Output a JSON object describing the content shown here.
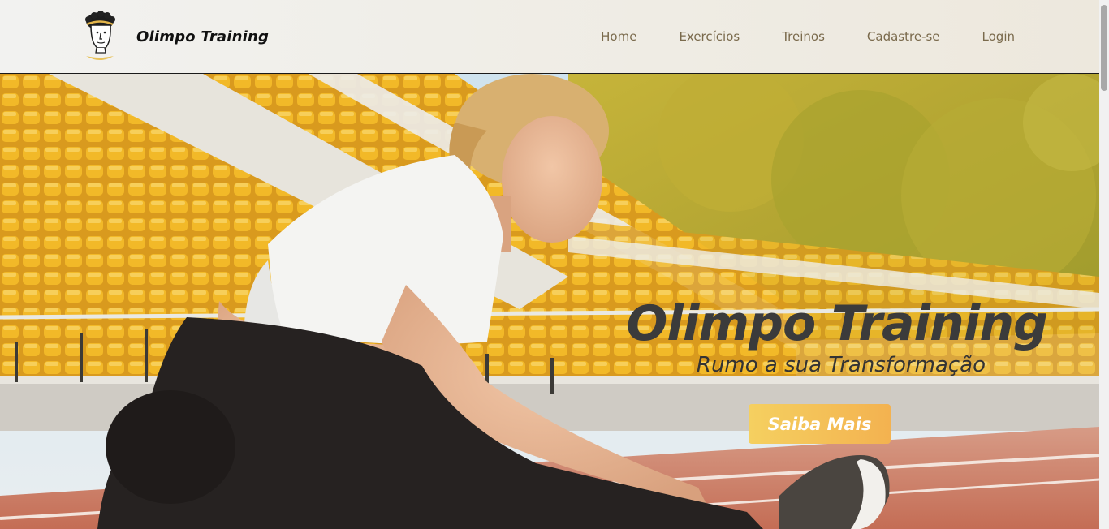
{
  "brand": {
    "name": "Olimpo Training",
    "logo_icon": "greek-god-bust-icon"
  },
  "nav": {
    "items": [
      {
        "label": "Home"
      },
      {
        "label": "Exercícios"
      },
      {
        "label": "Treinos"
      },
      {
        "label": "Cadastre-se"
      },
      {
        "label": "Login"
      }
    ],
    "color": "#7a6a4c"
  },
  "hero": {
    "title": "Olimpo Training",
    "subtitle": "Rumo a sua Transformação",
    "button_label": "Saiba Mais",
    "image_icon": "athlete-stretching-stadium-photo"
  },
  "colors": {
    "accent_start": "#f5d060",
    "accent_end": "#f3b250",
    "title": "#3b3b3b",
    "seat_yellow": "#f0b52a",
    "track": "#c97a63"
  }
}
